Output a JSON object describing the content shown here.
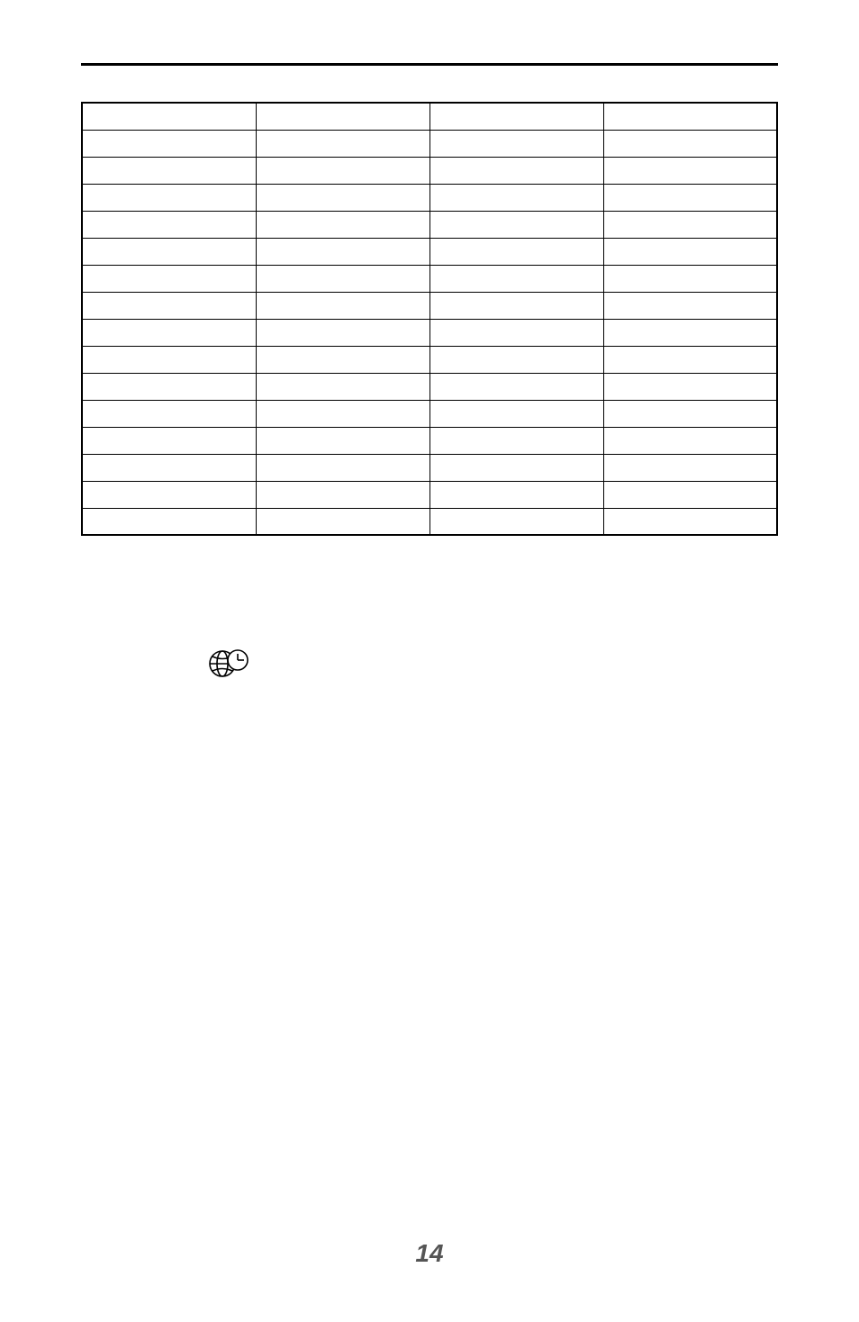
{
  "page": {
    "number": "14"
  },
  "table": {
    "rows": 16,
    "columns": 4
  },
  "icons": {
    "globe_clock": "globe-clock-icon"
  }
}
